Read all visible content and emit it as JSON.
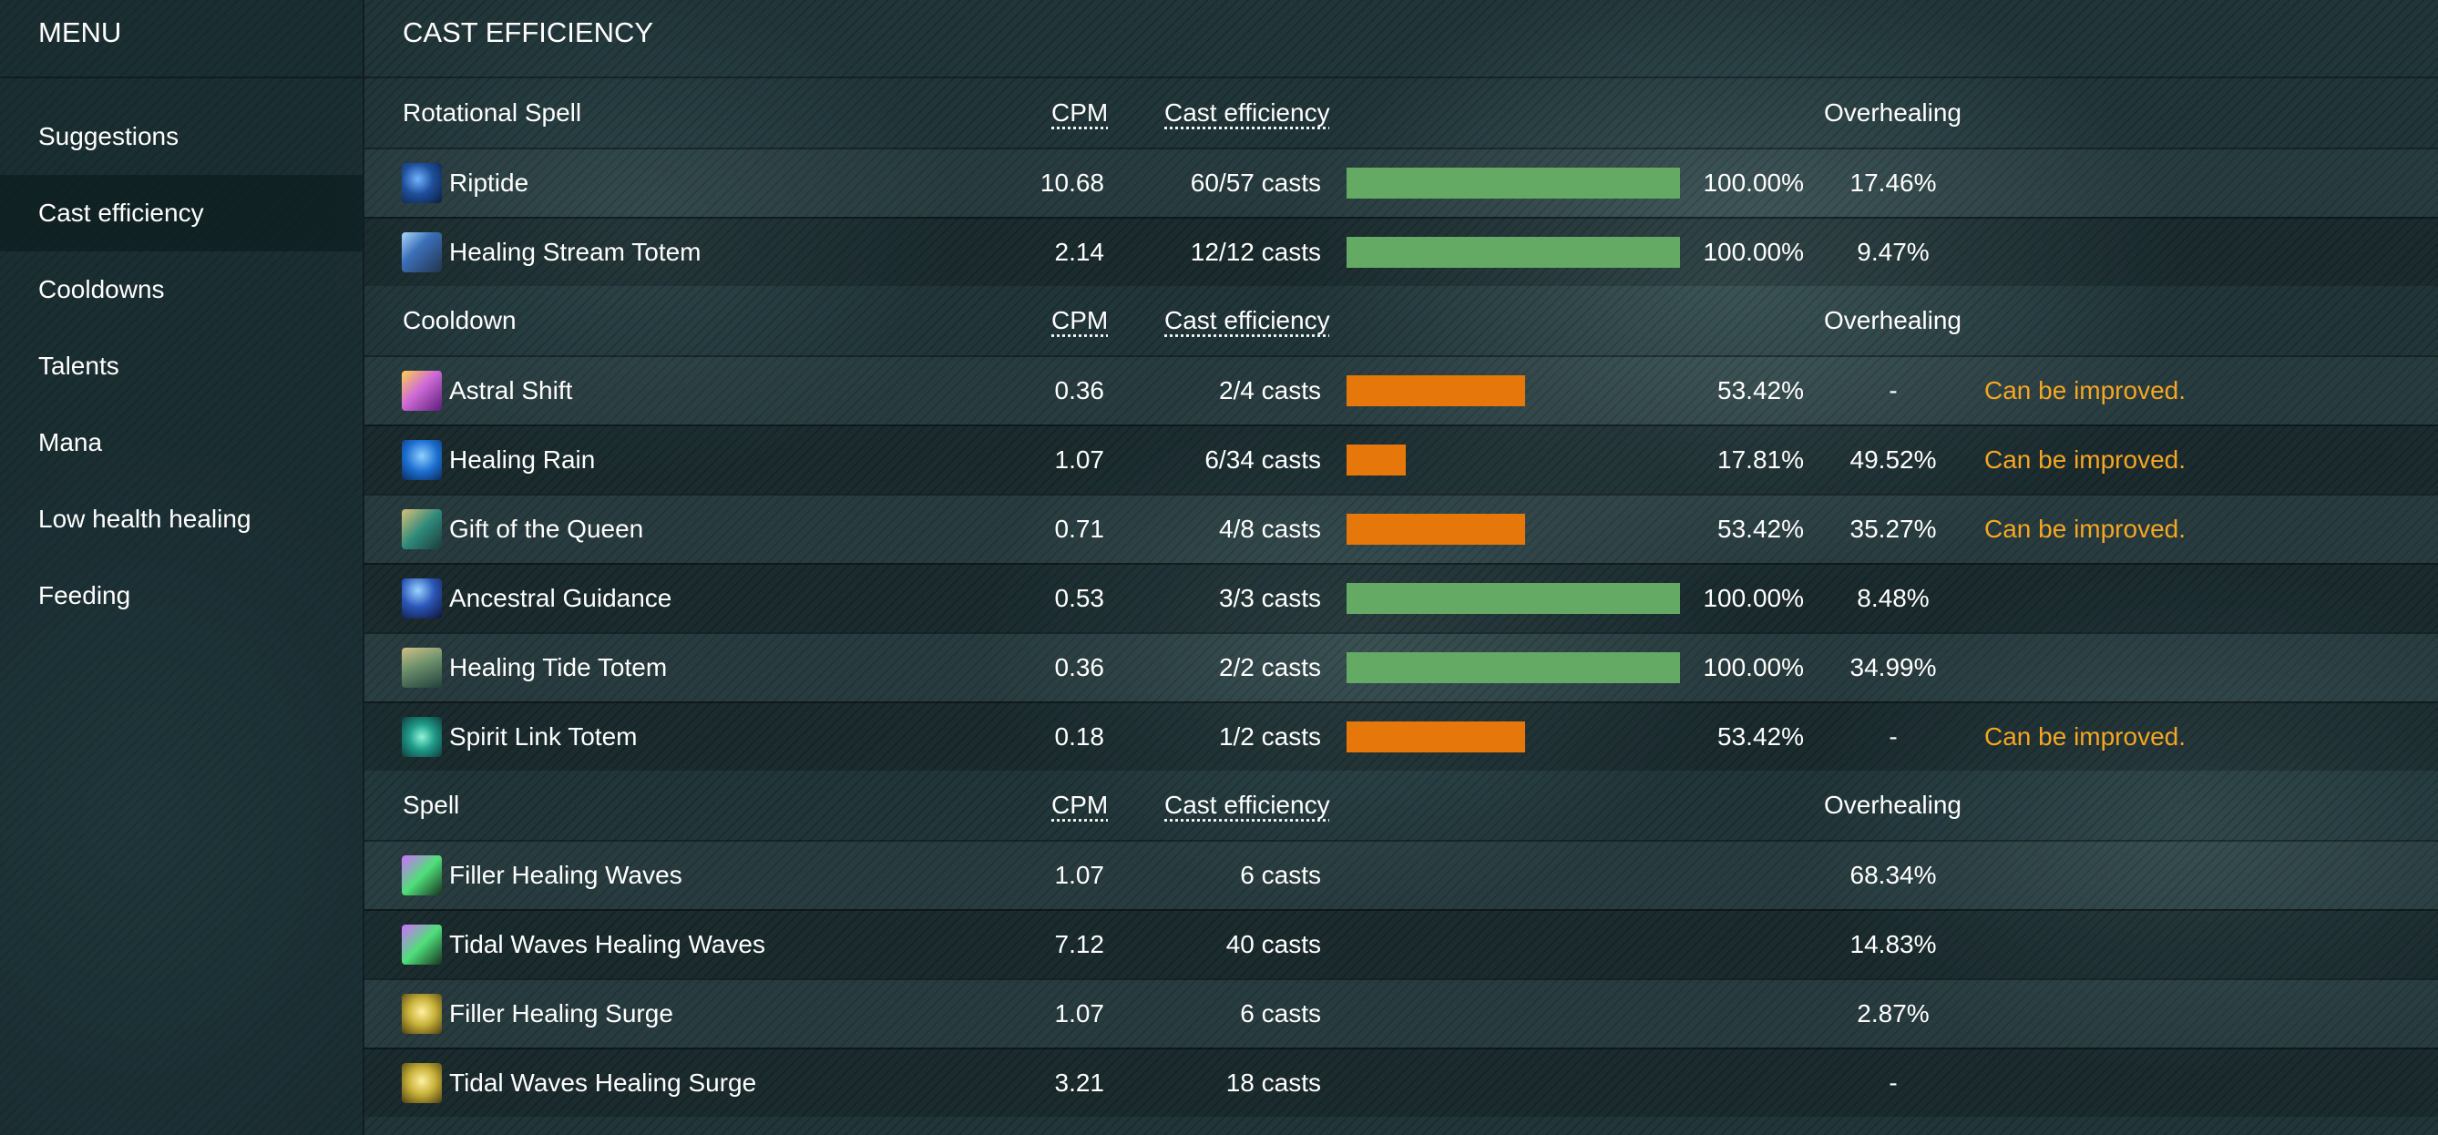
{
  "sidebar": {
    "title": "MENU",
    "items": [
      {
        "label": "Suggestions"
      },
      {
        "label": "Cast efficiency"
      },
      {
        "label": "Cooldowns"
      },
      {
        "label": "Talents"
      },
      {
        "label": "Mana"
      },
      {
        "label": "Low health healing"
      },
      {
        "label": "Feeding"
      }
    ],
    "active_item": "Cast efficiency"
  },
  "main": {
    "title": "CAST EFFICIENCY",
    "columns": {
      "cpm": "CPM",
      "cast_efficiency": "Cast efficiency",
      "overhealing": "Overhealing"
    },
    "colors": {
      "good": "#64a964",
      "needs_improvement": "#e5770b",
      "note": "#f5a623"
    },
    "sections": [
      {
        "title": "Rotational Spell",
        "rows": [
          {
            "icon": "riptide-icon",
            "name": "Riptide",
            "cpm": "10.68",
            "casts": "60/57 casts",
            "efficiency": 1.0,
            "efficiency_label": "100.00%",
            "overhealing": "17.46%",
            "note": ""
          },
          {
            "icon": "healing-stream-totem-icon",
            "name": "Healing Stream Totem",
            "cpm": "2.14",
            "casts": "12/12 casts",
            "efficiency": 1.0,
            "efficiency_label": "100.00%",
            "overhealing": "9.47%",
            "note": ""
          }
        ]
      },
      {
        "title": "Cooldown",
        "rows": [
          {
            "icon": "astral-shift-icon",
            "name": "Astral Shift",
            "cpm": "0.36",
            "casts": "2/4 casts",
            "efficiency": 0.5342,
            "efficiency_label": "53.42%",
            "overhealing": "-",
            "note": "Can be improved."
          },
          {
            "icon": "healing-rain-icon",
            "name": "Healing Rain",
            "cpm": "1.07",
            "casts": "6/34 casts",
            "efficiency": 0.1781,
            "efficiency_label": "17.81%",
            "overhealing": "49.52%",
            "note": "Can be improved."
          },
          {
            "icon": "gift-of-the-queen-icon",
            "name": "Gift of the Queen",
            "cpm": "0.71",
            "casts": "4/8 casts",
            "efficiency": 0.5342,
            "efficiency_label": "53.42%",
            "overhealing": "35.27%",
            "note": "Can be improved."
          },
          {
            "icon": "ancestral-guidance-icon",
            "name": "Ancestral Guidance",
            "cpm": "0.53",
            "casts": "3/3 casts",
            "efficiency": 1.0,
            "efficiency_label": "100.00%",
            "overhealing": "8.48%",
            "note": ""
          },
          {
            "icon": "healing-tide-totem-icon",
            "name": "Healing Tide Totem",
            "cpm": "0.36",
            "casts": "2/2 casts",
            "efficiency": 1.0,
            "efficiency_label": "100.00%",
            "overhealing": "34.99%",
            "note": ""
          },
          {
            "icon": "spirit-link-totem-icon",
            "name": "Spirit Link Totem",
            "cpm": "0.18",
            "casts": "1/2 casts",
            "efficiency": 0.5342,
            "efficiency_label": "53.42%",
            "overhealing": "-",
            "note": "Can be improved."
          }
        ]
      },
      {
        "title": "Spell",
        "rows": [
          {
            "icon": "healing-wave-icon",
            "name": "Filler Healing Waves",
            "cpm": "1.07",
            "casts": "6 casts",
            "efficiency": null,
            "efficiency_label": "",
            "overhealing": "68.34%",
            "note": ""
          },
          {
            "icon": "healing-wave-icon",
            "name": "Tidal Waves Healing Waves",
            "cpm": "7.12",
            "casts": "40 casts",
            "efficiency": null,
            "efficiency_label": "",
            "overhealing": "14.83%",
            "note": ""
          },
          {
            "icon": "healing-surge-icon",
            "name": "Filler Healing Surge",
            "cpm": "1.07",
            "casts": "6 casts",
            "efficiency": null,
            "efficiency_label": "",
            "overhealing": "2.87%",
            "note": ""
          },
          {
            "icon": "healing-surge-icon",
            "name": "Tidal Waves Healing Surge",
            "cpm": "3.21",
            "casts": "18 casts",
            "efficiency": null,
            "efficiency_label": "",
            "overhealing": "-",
            "note": ""
          }
        ]
      }
    ]
  }
}
